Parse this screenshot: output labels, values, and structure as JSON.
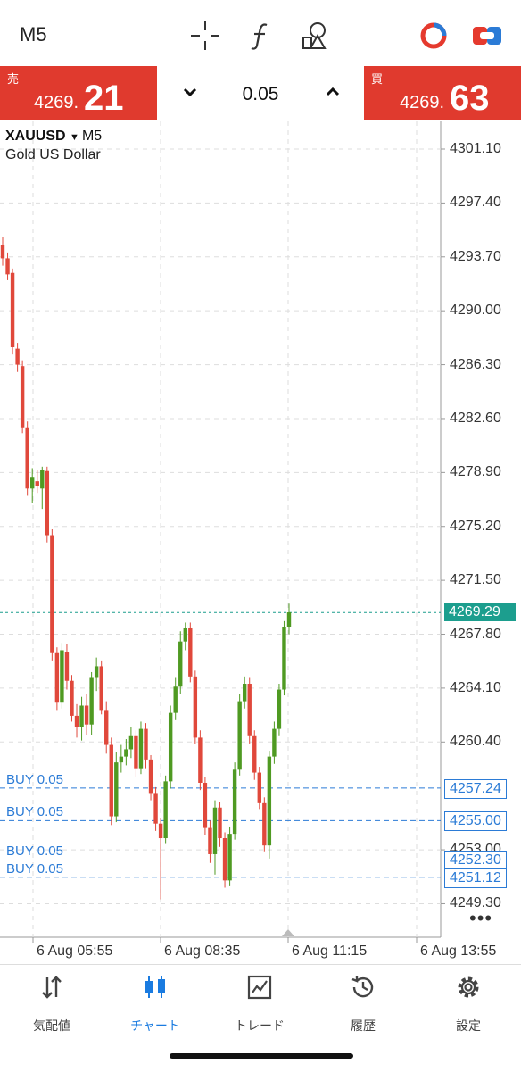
{
  "header": {
    "timeframe": "M5"
  },
  "trade": {
    "sell_label": "売",
    "sell_price_main": "4269.",
    "sell_price_big": "21",
    "buy_label": "買",
    "buy_price_main": "4269.",
    "buy_price_big": "63",
    "lot": "0.05"
  },
  "chart": {
    "symbol": "XAUUSD",
    "timeframe": "M5",
    "desc": "Gold US Dollar",
    "y_ticks": [
      "4301.10",
      "4297.40",
      "4293.70",
      "4290.00",
      "4286.30",
      "4282.60",
      "4278.90",
      "4275.20",
      "4271.50",
      "4267.80",
      "4264.10",
      "4260.40",
      "4253.00",
      "4249.30"
    ],
    "current_price": "4269.29",
    "orders": [
      {
        "label": "BUY 0.05",
        "price": "4257.24"
      },
      {
        "label": "BUY 0.05",
        "price": "4255.00"
      },
      {
        "label": "BUY 0.05",
        "price": "4252.30"
      },
      {
        "label": "BUY 0.05",
        "price": "4251.12"
      }
    ],
    "x_ticks": [
      "6 Aug 05:55",
      "6 Aug 08:35",
      "6 Aug 11:15",
      "6 Aug 13:55"
    ],
    "colors": {
      "bull": "#4f9a22",
      "bear": "#e0483b",
      "current": "#1c9e8e",
      "order": "#2b7bd6"
    }
  },
  "tabs": [
    {
      "label": "気配値",
      "icon": "quotes-icon"
    },
    {
      "label": "チャート",
      "icon": "chart-icon"
    },
    {
      "label": "トレード",
      "icon": "trade-icon"
    },
    {
      "label": "履歴",
      "icon": "history-icon"
    },
    {
      "label": "設定",
      "icon": "settings-icon"
    }
  ],
  "chart_data": {
    "type": "candlestick",
    "title": "XAUUSD M5",
    "ylim": [
      4247.0,
      4303.0
    ],
    "x_ticks": [
      "6 Aug 05:55",
      "6 Aug 08:35",
      "6 Aug 11:15",
      "6 Aug 13:55"
    ],
    "candles": [
      {
        "o": 4294.5,
        "h": 4295.1,
        "l": 4293.1,
        "c": 4293.6
      },
      {
        "o": 4293.6,
        "h": 4294.0,
        "l": 4292.1,
        "c": 4292.5
      },
      {
        "o": 4292.6,
        "h": 4292.9,
        "l": 4287.0,
        "c": 4287.5
      },
      {
        "o": 4287.4,
        "h": 4287.8,
        "l": 4285.8,
        "c": 4286.3
      },
      {
        "o": 4286.2,
        "h": 4286.6,
        "l": 4281.6,
        "c": 4282.0
      },
      {
        "o": 4282.0,
        "h": 4282.4,
        "l": 4277.3,
        "c": 4277.8
      },
      {
        "o": 4277.8,
        "h": 4279.2,
        "l": 4276.8,
        "c": 4278.6
      },
      {
        "o": 4278.3,
        "h": 4279.1,
        "l": 4277.5,
        "c": 4278.0
      },
      {
        "o": 4277.8,
        "h": 4279.3,
        "l": 4276.4,
        "c": 4279.1
      },
      {
        "o": 4279.0,
        "h": 4279.3,
        "l": 4274.1,
        "c": 4274.6
      },
      {
        "o": 4274.6,
        "h": 4275.0,
        "l": 4266.0,
        "c": 4266.5
      },
      {
        "o": 4266.5,
        "h": 4266.9,
        "l": 4262.6,
        "c": 4263.1
      },
      {
        "o": 4263.1,
        "h": 4267.2,
        "l": 4262.7,
        "c": 4266.7
      },
      {
        "o": 4266.6,
        "h": 4267.1,
        "l": 4264.0,
        "c": 4264.6
      },
      {
        "o": 4264.6,
        "h": 4265.0,
        "l": 4261.8,
        "c": 4262.2
      },
      {
        "o": 4262.2,
        "h": 4263.0,
        "l": 4260.7,
        "c": 4261.4
      },
      {
        "o": 4261.4,
        "h": 4263.5,
        "l": 4260.5,
        "c": 4262.9
      },
      {
        "o": 4262.9,
        "h": 4263.7,
        "l": 4260.9,
        "c": 4261.6
      },
      {
        "o": 4261.6,
        "h": 4265.2,
        "l": 4260.9,
        "c": 4264.8
      },
      {
        "o": 4264.8,
        "h": 4266.2,
        "l": 4263.9,
        "c": 4265.6
      },
      {
        "o": 4265.6,
        "h": 4266.0,
        "l": 4262.3,
        "c": 4262.6
      },
      {
        "o": 4262.6,
        "h": 4263.2,
        "l": 4259.6,
        "c": 4260.2
      },
      {
        "o": 4260.2,
        "h": 4260.7,
        "l": 4254.7,
        "c": 4255.3
      },
      {
        "o": 4255.3,
        "h": 4259.7,
        "l": 4254.9,
        "c": 4259.0
      },
      {
        "o": 4259.0,
        "h": 4260.2,
        "l": 4258.3,
        "c": 4259.4
      },
      {
        "o": 4259.4,
        "h": 4260.6,
        "l": 4258.8,
        "c": 4259.9
      },
      {
        "o": 4259.9,
        "h": 4261.4,
        "l": 4259.3,
        "c": 4260.8
      },
      {
        "o": 4260.8,
        "h": 4261.2,
        "l": 4258.0,
        "c": 4258.6
      },
      {
        "o": 4258.6,
        "h": 4261.8,
        "l": 4258.2,
        "c": 4261.3
      },
      {
        "o": 4261.3,
        "h": 4261.7,
        "l": 4258.6,
        "c": 4259.2
      },
      {
        "o": 4259.2,
        "h": 4259.5,
        "l": 4256.4,
        "c": 4256.9
      },
      {
        "o": 4256.9,
        "h": 4257.3,
        "l": 4254.3,
        "c": 4254.8
      },
      {
        "o": 4254.8,
        "h": 4255.2,
        "l": 4249.6,
        "c": 4253.8
      },
      {
        "o": 4253.8,
        "h": 4258.1,
        "l": 4253.4,
        "c": 4257.7
      },
      {
        "o": 4257.7,
        "h": 4262.9,
        "l": 4257.2,
        "c": 4262.4
      },
      {
        "o": 4262.4,
        "h": 4264.8,
        "l": 4261.9,
        "c": 4264.2
      },
      {
        "o": 4264.2,
        "h": 4268.0,
        "l": 4263.7,
        "c": 4267.3
      },
      {
        "o": 4267.3,
        "h": 4268.6,
        "l": 4266.7,
        "c": 4268.2
      },
      {
        "o": 4268.2,
        "h": 4268.6,
        "l": 4264.5,
        "c": 4264.9
      },
      {
        "o": 4264.9,
        "h": 4265.3,
        "l": 4260.3,
        "c": 4260.7
      },
      {
        "o": 4260.7,
        "h": 4261.2,
        "l": 4257.1,
        "c": 4257.6
      },
      {
        "o": 4257.6,
        "h": 4258.0,
        "l": 4254.0,
        "c": 4254.5
      },
      {
        "o": 4254.5,
        "h": 4255.0,
        "l": 4252.1,
        "c": 4252.7
      },
      {
        "o": 4252.7,
        "h": 4256.4,
        "l": 4251.3,
        "c": 4255.9
      },
      {
        "o": 4255.9,
        "h": 4256.3,
        "l": 4253.2,
        "c": 4253.8
      },
      {
        "o": 4253.8,
        "h": 4254.2,
        "l": 4250.4,
        "c": 4250.9
      },
      {
        "o": 4250.9,
        "h": 4254.6,
        "l": 4250.5,
        "c": 4254.1
      },
      {
        "o": 4254.1,
        "h": 4259.0,
        "l": 4253.7,
        "c": 4258.5
      },
      {
        "o": 4258.5,
        "h": 4263.7,
        "l": 4258.1,
        "c": 4263.2
      },
      {
        "o": 4263.2,
        "h": 4264.9,
        "l": 4262.7,
        "c": 4264.4
      },
      {
        "o": 4264.4,
        "h": 4264.8,
        "l": 4260.3,
        "c": 4260.8
      },
      {
        "o": 4260.8,
        "h": 4261.2,
        "l": 4257.8,
        "c": 4258.3
      },
      {
        "o": 4258.3,
        "h": 4258.7,
        "l": 4255.8,
        "c": 4256.2
      },
      {
        "o": 4256.2,
        "h": 4256.6,
        "l": 4252.9,
        "c": 4253.3
      },
      {
        "o": 4253.3,
        "h": 4259.8,
        "l": 4252.4,
        "c": 4259.4
      },
      {
        "o": 4259.4,
        "h": 4261.8,
        "l": 4258.9,
        "c": 4261.3
      },
      {
        "o": 4261.3,
        "h": 4264.4,
        "l": 4260.8,
        "c": 4264.0
      },
      {
        "o": 4264.0,
        "h": 4268.7,
        "l": 4263.6,
        "c": 4268.3
      },
      {
        "o": 4268.3,
        "h": 4269.9,
        "l": 4267.8,
        "c": 4269.3
      }
    ]
  }
}
